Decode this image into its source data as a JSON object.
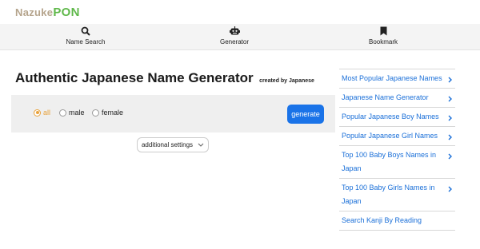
{
  "logo": {
    "part1": "Nazuke",
    "part2": "PON"
  },
  "nav": {
    "name_search": "Name Search",
    "generator": "Generator",
    "bookmark": "Bookmark"
  },
  "page": {
    "title": "Authentic Japanese Name Generator",
    "subtitle": "created by Japanese"
  },
  "gender": {
    "options": [
      "all",
      "male",
      "female"
    ],
    "selected": "all"
  },
  "generate_label": "generate",
  "settings_label": "additional settings",
  "sidebar": {
    "items": [
      "Most Popular Japanese Names",
      "Japanese Name Generator",
      "Popular Japanese Boy Names",
      "Popular Japanese Girl Names",
      "Top 100 Baby Boys Names in Japan",
      "Top 100 Baby Girls Names in Japan",
      "Search Kanji By Reading"
    ]
  },
  "colors": {
    "accent": "#1a73e8",
    "selected": "#e8a23c",
    "logo_green": "#5fb84a",
    "logo_tan": "#b5a48c"
  },
  "icons": [
    "search-icon",
    "robot-icon",
    "bookmark-icon",
    "chevron-down-icon",
    "chevron-right-icon"
  ]
}
